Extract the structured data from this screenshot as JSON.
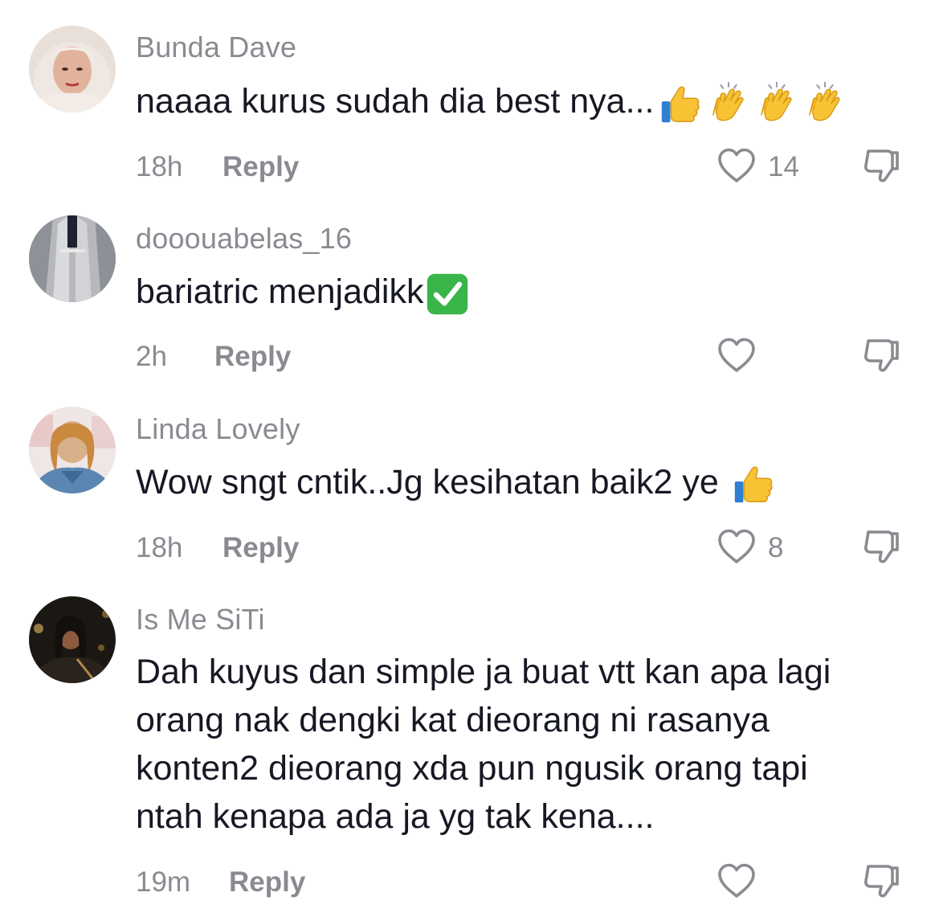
{
  "comments": [
    {
      "username": "Bunda Dave",
      "text": "naaaa kurus sudah dia best nya...",
      "emojis": [
        "thumbs-up-icon",
        "clapping-hands-icon",
        "clapping-hands-icon",
        "clapping-hands-icon"
      ],
      "time": "18h",
      "reply_label": "Reply",
      "likes": "14"
    },
    {
      "username": "dooouabelas_16",
      "text": "bariatric menjadikk",
      "emojis": [
        "check-mark-button-icon"
      ],
      "time": "2h",
      "reply_label": "Reply",
      "likes": ""
    },
    {
      "username": "Linda Lovely",
      "text": "Wow sngt cntik..Jg kesihatan baik2 ye",
      "emojis": [
        "thumbs-up-icon"
      ],
      "time": "18h",
      "reply_label": "Reply",
      "likes": "8"
    },
    {
      "username": "Is Me SiTi",
      "lines": [
        "Dah kuyus dan simple ja buat vtt kan apa lagi",
        "orang nak dengki kat dieorang ni rasanya",
        "konten2 dieorang xda pun ngusik orang tapi",
        "ntah kenapa ada ja yg tak kena...."
      ],
      "time": "19m",
      "reply_label": "Reply",
      "likes": ""
    }
  ],
  "colors": {
    "primary_text": "#161823",
    "secondary_text": "#8a8b91",
    "emoji_yellow": "#f7c234",
    "check_green": "#3ab54a"
  }
}
